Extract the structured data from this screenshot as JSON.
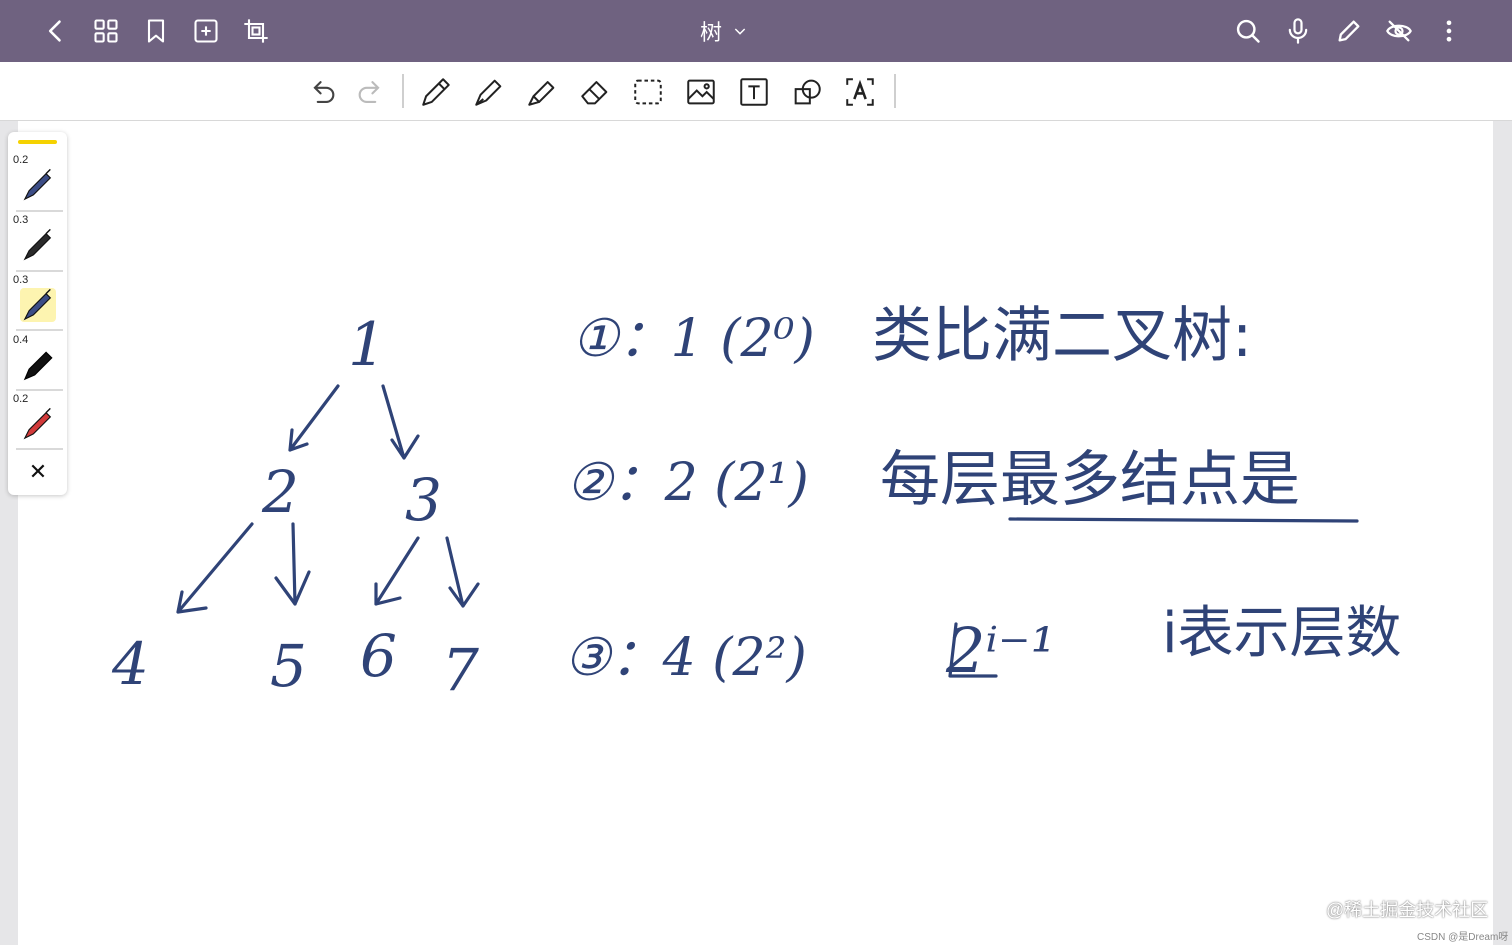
{
  "header": {
    "title": "树",
    "icons": [
      "back-icon",
      "grid-icon",
      "bookmark-icon",
      "add-page-icon",
      "crop-icon",
      "search-icon",
      "microphone-icon",
      "pen-icon",
      "eye-off-icon",
      "more-icon"
    ]
  },
  "toolbar": {
    "tools": [
      "undo",
      "redo",
      "pen",
      "fountain-pen",
      "highlighter",
      "eraser",
      "lasso-select",
      "image",
      "text-box",
      "shape",
      "text-recognition"
    ]
  },
  "pen_panel": {
    "highlight_color": "#f5d200",
    "pens": [
      {
        "size": "0.2",
        "color": "#3c4d86"
      },
      {
        "size": "0.3",
        "color": "#2b2b2b"
      },
      {
        "size": "0.3",
        "color": "#3c4d86"
      },
      {
        "size": "0.4",
        "color": "#111111"
      },
      {
        "size": "0.2",
        "color": "#d23a3a"
      }
    ],
    "close_label": "✕"
  },
  "ink": {
    "color": "#2f4377",
    "tree_nodes": [
      "1",
      "2",
      "3",
      "4",
      "5",
      "6",
      "7"
    ],
    "lines": [
      "①：1 (2⁰)",
      "②：2 (2¹)",
      "③：4 (2²)"
    ],
    "note1": "类比满二叉树:",
    "note2": "每层最多结点是",
    "formula": "2ⁱ⁻¹",
    "note3": "i表示层数"
  },
  "watermark": {
    "main": "@稀土掘金技术社区",
    "small": "CSDN @是Dream呀"
  }
}
